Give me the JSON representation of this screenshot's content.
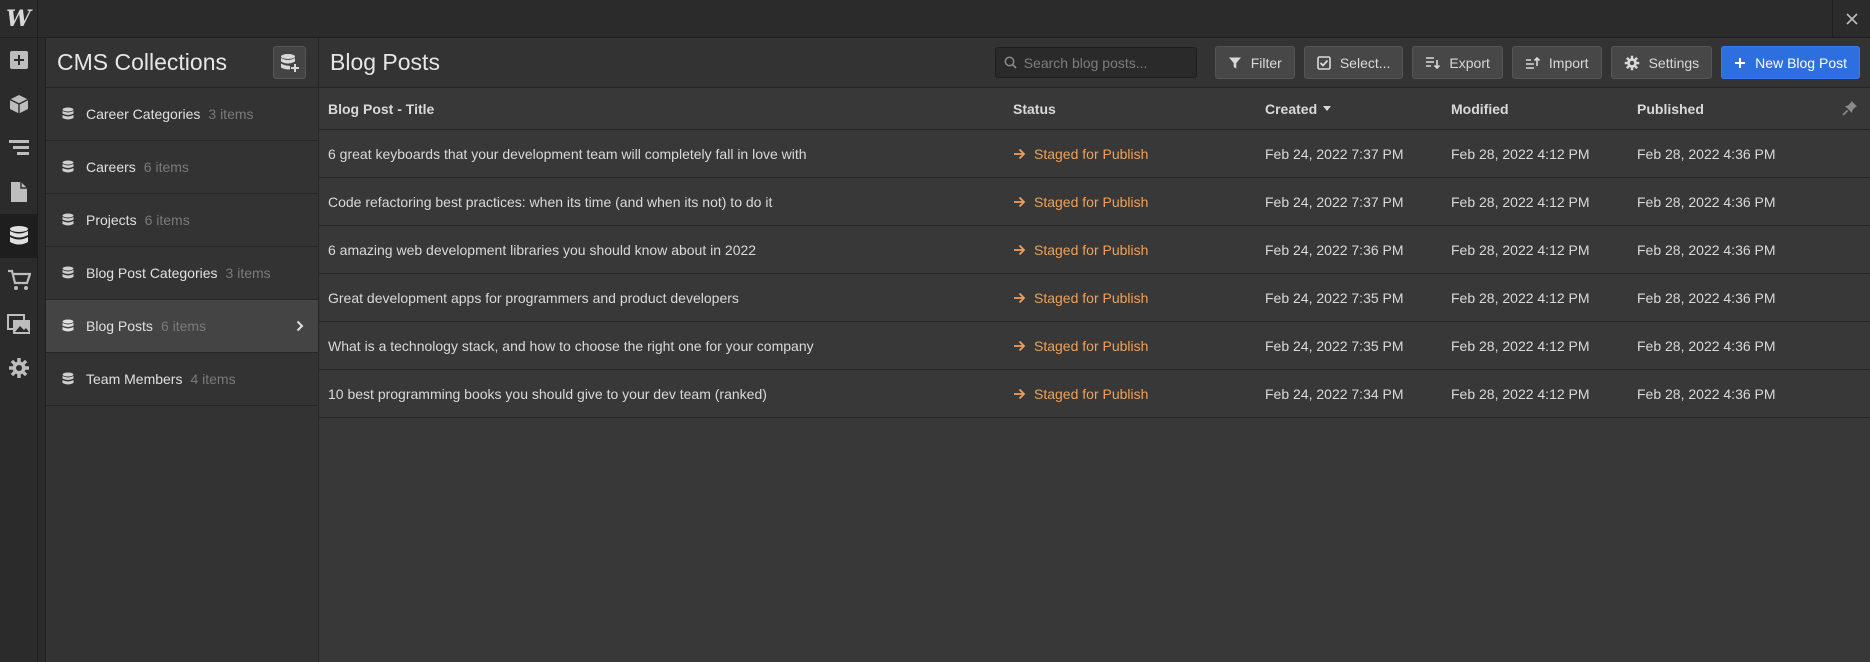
{
  "app": {
    "logo": "W"
  },
  "rail": [
    {
      "icon": "add-panel-icon"
    },
    {
      "icon": "box-icon"
    },
    {
      "icon": "navigator-icon"
    },
    {
      "icon": "pages-icon"
    },
    {
      "icon": "database-icon",
      "active": true
    },
    {
      "icon": "cart-icon"
    },
    {
      "icon": "assets-icon"
    },
    {
      "icon": "settings-icon"
    }
  ],
  "collections": {
    "title": "CMS Collections",
    "items": [
      {
        "name": "Career Categories",
        "count": "3 items"
      },
      {
        "name": "Careers",
        "count": "6 items"
      },
      {
        "name": "Projects",
        "count": "6 items"
      },
      {
        "name": "Blog Post Categories",
        "count": "3 items"
      },
      {
        "name": "Blog Posts",
        "count": "6 items",
        "active": true
      },
      {
        "name": "Team Members",
        "count": "4 items"
      }
    ]
  },
  "main": {
    "title": "Blog Posts",
    "search_placeholder": "Search blog posts...",
    "buttons": {
      "filter": "Filter",
      "select": "Select...",
      "export": "Export",
      "import": "Import",
      "settings": "Settings",
      "new": "New Blog Post"
    },
    "columns": {
      "title": "Blog Post - Title",
      "status": "Status",
      "created": "Created",
      "modified": "Modified",
      "published": "Published"
    },
    "rows": [
      {
        "title": "6 great keyboards that your development team will completely fall in love with",
        "status": "Staged for Publish",
        "created": "Feb 24, 2022 7:37 PM",
        "modified": "Feb 28, 2022 4:12 PM",
        "published": "Feb 28, 2022 4:36 PM"
      },
      {
        "title": "Code refactoring best practices: when its time (and when its not) to do it",
        "status": "Staged for Publish",
        "created": "Feb 24, 2022 7:37 PM",
        "modified": "Feb 28, 2022 4:12 PM",
        "published": "Feb 28, 2022 4:36 PM"
      },
      {
        "title": "6 amazing web development libraries you should know about in 2022",
        "status": "Staged for Publish",
        "created": "Feb 24, 2022 7:36 PM",
        "modified": "Feb 28, 2022 4:12 PM",
        "published": "Feb 28, 2022 4:36 PM"
      },
      {
        "title": "Great development apps for programmers and product developers",
        "status": "Staged for Publish",
        "created": "Feb 24, 2022 7:35 PM",
        "modified": "Feb 28, 2022 4:12 PM",
        "published": "Feb 28, 2022 4:36 PM"
      },
      {
        "title": "What is a technology stack, and how to choose the right one for your company",
        "status": "Staged for Publish",
        "created": "Feb 24, 2022 7:35 PM",
        "modified": "Feb 28, 2022 4:12 PM",
        "published": "Feb 28, 2022 4:36 PM"
      },
      {
        "title": "10 best programming books you should give to your dev team (ranked)",
        "status": "Staged for Publish",
        "created": "Feb 24, 2022 7:34 PM",
        "modified": "Feb 28, 2022 4:12 PM",
        "published": "Feb 28, 2022 4:36 PM"
      }
    ]
  },
  "colors": {
    "accent": "#2e6fe0",
    "staged": "#f0a05a"
  }
}
